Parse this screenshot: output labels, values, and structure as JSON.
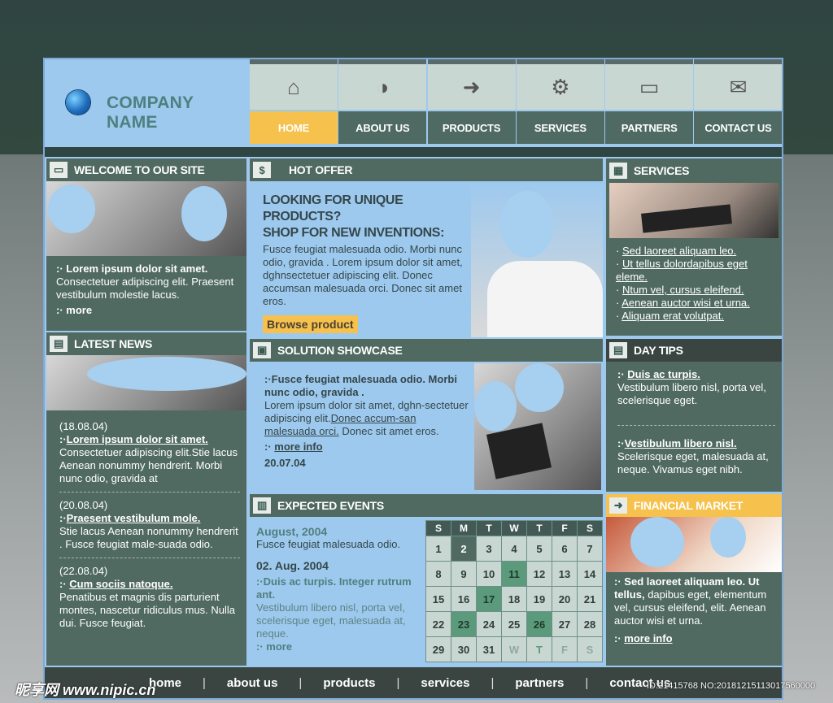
{
  "header": {
    "company_name": "COMPANY NAME",
    "nav": [
      {
        "label": "HOME",
        "icon": "house-icon",
        "glyph": "⌂",
        "active": true
      },
      {
        "label": "ABOUT US",
        "icon": "disc-icon",
        "glyph": "◑",
        "active": false
      },
      {
        "label": "PRODUCTS",
        "icon": "document-arrow-icon",
        "glyph": "➜",
        "active": false
      },
      {
        "label": "SERVICES",
        "icon": "gear-icon",
        "glyph": "⚙",
        "active": false
      },
      {
        "label": "PARTNERS",
        "icon": "card-icon",
        "glyph": "▭",
        "active": false
      },
      {
        "label": "CONTACT US",
        "icon": "envelope-icon",
        "glyph": "✉",
        "active": false
      }
    ]
  },
  "welcome": {
    "title": "WELCOME TO OUR SITE",
    "headline": "Lorem ipsum dolor sit amet.",
    "text": "Consectetuer adipiscing elit. Praesent vestibulum molestie lacus.",
    "more": "more"
  },
  "news": {
    "title": "LATEST NEWS",
    "items": [
      {
        "date": "(18.08.04)",
        "headline": "Lorem ipsum dolor sit amet.",
        "text": "Consectetuer adipiscing elit.Stie lacus Aenean nonummy hendrerit. Morbi nunc odio, gravida at"
      },
      {
        "date": "(20.08.04)",
        "headline": "Praesent vestibulum mole.",
        "text": "Stie lacus Aenean nonummy hendrerit . Fusce feugiat male-suada odio."
      },
      {
        "date": "(22.08.04)",
        "headline": "Cum sociis natoque.",
        "text": "Penatibus et magnis dis parturient montes, nascetur ridiculus mus. Nulla dui. Fusce feugiat."
      }
    ]
  },
  "hot_offer": {
    "title": "HOT OFFER",
    "heading1": "LOOKING FOR UNIQUE PRODUCTS?",
    "heading2": "SHOP FOR NEW INVENTIONS:",
    "text": "Fusce feugiat malesuada odio. Morbi nunc odio, gravida . Lorem ipsum dolor sit amet, dghnsectetuer adipiscing elit. Donec accumsan malesuada orci. Donec sit amet eros.",
    "button": "Browse product"
  },
  "solution": {
    "title": "SOLUTION SHOWCASE",
    "headline": "Fusce feugiat malesuada odio. Morbi nunc odio, gravida .",
    "text_a": "Lorem ipsum dolor sit amet, dghn-sectetuer adipiscing elit.",
    "link": "Donec accum-san malesuada orci.",
    "text_b": " Donec sit amet eros.",
    "more": "more info",
    "date": "20.07.04"
  },
  "events": {
    "title": "EXPECTED EVENTS",
    "month": "August, 2004",
    "month_text": "Fusce feugiat malesuada odio.",
    "date": "02. Aug. 2004",
    "headline": "Duis ac turpis. Integer rutrum ant.",
    "text": "Vestibulum libero nisl, porta vel, scelerisque eget, malesuada at, neque.",
    "more": "more",
    "calendar": {
      "days": [
        "S",
        "M",
        "T",
        "W",
        "T",
        "F",
        "S"
      ],
      "weeks": [
        [
          "1",
          "2",
          "3",
          "4",
          "5",
          "6",
          "7"
        ],
        [
          "8",
          "9",
          "10",
          "11",
          "12",
          "13",
          "14"
        ],
        [
          "15",
          "16",
          "17",
          "18",
          "19",
          "20",
          "21"
        ],
        [
          "22",
          "23",
          "24",
          "25",
          "26",
          "27",
          "28"
        ],
        [
          "29",
          "30",
          "31",
          "W",
          "T",
          "F",
          "S"
        ]
      ]
    }
  },
  "services": {
    "title": "SERVICES",
    "links": [
      "Sed laoreet aliquam leo.",
      "Ut tellus dolordapibus eget eleme.",
      "Ntum vel, cursus eleifend.",
      "Aenean auctor wisi et urna.",
      "Aliquam erat volutpat."
    ]
  },
  "day_tips": {
    "title": "DAY TIPS",
    "tip1_headline": "Duis ac turpis.",
    "tip1_text": "Vestibulum libero nisl, porta vel,  scelerisque eget.",
    "tip2_headline": "Vestibulum libero nisl.",
    "tip2_text": "Scelerisque eget, malesuada at, neque. Vivamus eget nibh."
  },
  "financial": {
    "title": "FINANCIAL MARKET",
    "headline": "Sed laoreet aliquam leo. Ut tellus,",
    "text": " dapibus eget, elementum vel, cursus eleifend, elit. Aenean auctor wisi et urna.",
    "more": "more info"
  },
  "footer": {
    "links": [
      "home",
      "about us",
      "products",
      "services",
      "partners",
      "contact us"
    ]
  },
  "watermark": {
    "site": "昵享网 www.nipic.cn",
    "id": "ID:21415768 NO:20181215113017560000"
  }
}
